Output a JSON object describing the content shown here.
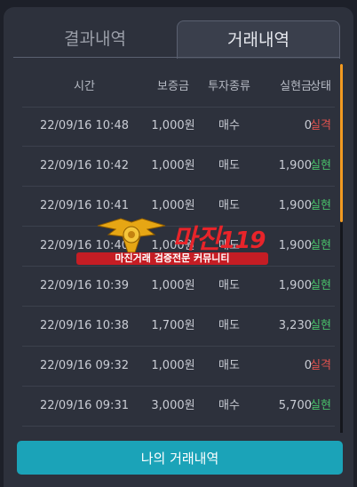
{
  "tabs": [
    {
      "label": "결과내역",
      "active": false
    },
    {
      "label": "거래내역",
      "active": true
    }
  ],
  "table": {
    "headers": [
      "시간",
      "보증금",
      "투자종류",
      "실현금",
      "상태"
    ],
    "rows": [
      [
        "22/09/16 10:48",
        "1,000원",
        "매수",
        "0",
        "실격"
      ],
      [
        "22/09/16 10:42",
        "1,000원",
        "매도",
        "1,900",
        "실현"
      ],
      [
        "22/09/16 10:41",
        "1,000원",
        "매도",
        "1,900",
        "실현"
      ],
      [
        "22/09/16 10:40",
        "1,000원",
        "매도",
        "1,900",
        "실현"
      ],
      [
        "22/09/16 10:39",
        "1,000원",
        "매도",
        "1,900",
        "실현"
      ],
      [
        "22/09/16 10:38",
        "1,700원",
        "매도",
        "3,230",
        "실현"
      ],
      [
        "22/09/16 09:32",
        "1,000원",
        "매도",
        "0",
        "실격"
      ],
      [
        "22/09/16 09:31",
        "3,000원",
        "매수",
        "5,700",
        "실현"
      ]
    ]
  },
  "watermark": {
    "logo_text": "마진",
    "logo_suffix": "119",
    "tagline": "마진거래 검증전문 커뮤니티"
  },
  "bottom_button": "나의 거래내역",
  "colors": {
    "fail": "#e0524e",
    "win": "#48c16a",
    "accent": "#1ba3b8",
    "scroll": "#f29a21"
  }
}
